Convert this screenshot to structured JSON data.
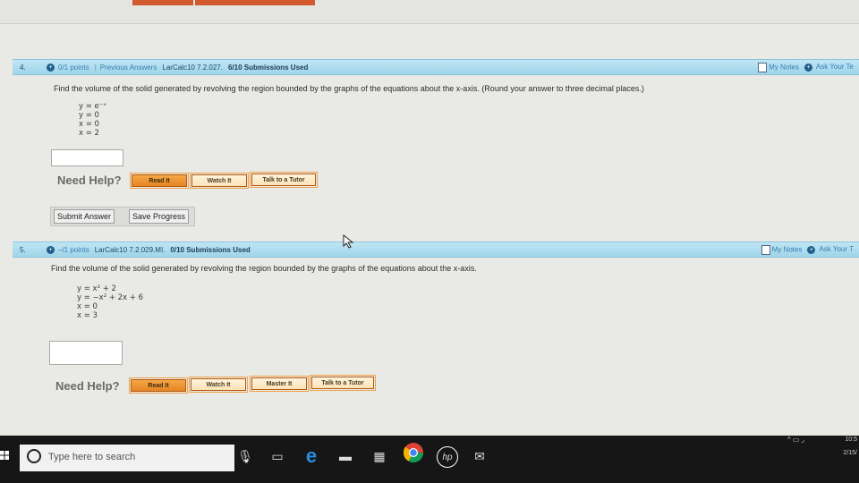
{
  "top": {
    "title_fragment": "Need Help?"
  },
  "q4": {
    "number": "4.",
    "points": "0/1 points",
    "separator": "|",
    "previous": "Previous Answers",
    "code": "LarCalc10 7.2.027.",
    "submissions": "6/10 Submissions Used",
    "my_notes": "My Notes",
    "ask": "Ask Your Te",
    "prompt": "Find the volume of the solid generated by revolving the region bounded by the graphs of the equations about the x-axis. (Round your answer to three decimal places.)",
    "equations": [
      "y = e⁻ˣ",
      "y = 0",
      "x = 0",
      "x = 2"
    ],
    "answer_value": "",
    "need_help": "Need Help?",
    "buttons": [
      "Read It",
      "Watch It",
      "Talk to a Tutor"
    ],
    "submit": "Submit Answer",
    "save": "Save Progress"
  },
  "q5": {
    "number": "5.",
    "points": "–/1 points",
    "code": "LarCalc10 7.2.029.MI.",
    "submissions": "0/10 Submissions Used",
    "my_notes": "My Notes",
    "ask": "Ask Your T",
    "prompt": "Find the volume of the solid generated by revolving the region bounded by the graphs of the equations about the x-axis.",
    "equations": [
      "y = x² + 2",
      "y = −x² + 2x + 6",
      "x = 0",
      "x = 3"
    ],
    "answer_value": "",
    "need_help": "Need Help?",
    "buttons": [
      "Read It",
      "Watch It",
      "Master It",
      "Talk to a Tutor"
    ]
  },
  "taskbar": {
    "search_placeholder": "Type here to search",
    "time": "10:5",
    "date": "2/15/"
  },
  "colors": {
    "header_blue": "#9fd4ea",
    "help_orange": "#e68522",
    "taskbar": "#161616"
  }
}
